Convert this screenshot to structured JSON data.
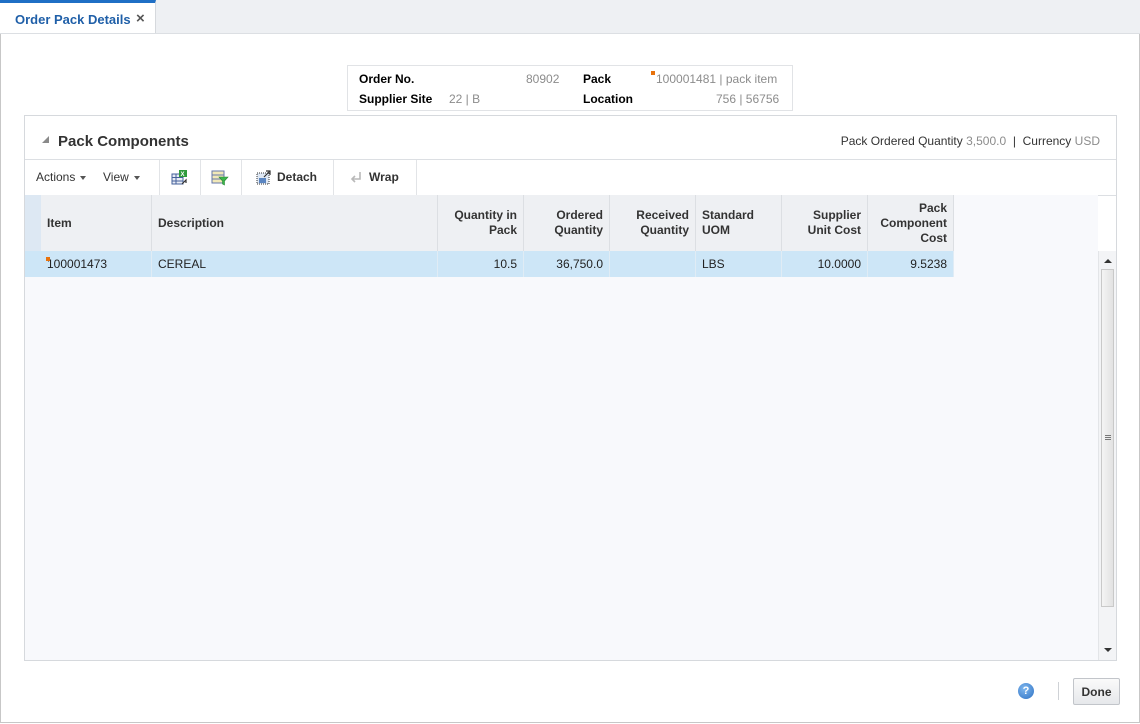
{
  "tab": {
    "label": "Order Pack Details",
    "close_icon": "close-icon"
  },
  "header": {
    "order_no_label": "Order No.",
    "order_no_value": "80902",
    "supplier_site_label": "Supplier Site",
    "supplier_site_value": "22 | B",
    "pack_label": "Pack",
    "pack_value": "100001481 | pack item",
    "location_label": "Location",
    "location_value": "756 | 56756"
  },
  "panel": {
    "title": "Pack Components",
    "pack_ordered_quantity_label": "Pack Ordered Quantity",
    "pack_ordered_quantity_value": "3,500.0",
    "separator": "|",
    "currency_label": "Currency",
    "currency_value": "USD"
  },
  "toolbar": {
    "actions_label": "Actions",
    "view_label": "View",
    "export_icon": "export-to-excel-icon",
    "filter_icon": "query-by-example-icon",
    "detach_label": "Detach",
    "wrap_label": "Wrap"
  },
  "table": {
    "columns": [
      {
        "key": "item",
        "label": "Item"
      },
      {
        "key": "description",
        "label": "Description"
      },
      {
        "key": "qty_in_pack",
        "label": "Quantity in Pack"
      },
      {
        "key": "ordered_qty",
        "label": "Ordered Quantity"
      },
      {
        "key": "received_qty",
        "label": "Received Quantity"
      },
      {
        "key": "standard_uom",
        "label": "Standard UOM"
      },
      {
        "key": "supplier_unit_cost",
        "label": "Supplier Unit Cost"
      },
      {
        "key": "pack_component_cost",
        "label": "Pack Component Cost"
      }
    ],
    "rows": [
      {
        "item": "100001473",
        "description": "CEREAL",
        "qty_in_pack": "10.5",
        "ordered_qty": "36,750.0",
        "received_qty": "",
        "standard_uom": "LBS",
        "supplier_unit_cost": "10.0000",
        "pack_component_cost": "9.5238"
      }
    ]
  },
  "footer": {
    "help_label": "?",
    "done_label": "Done"
  },
  "colors": {
    "accent": "#1f6fc5",
    "selected_row": "#cde6f7",
    "marker": "#e8720c"
  }
}
